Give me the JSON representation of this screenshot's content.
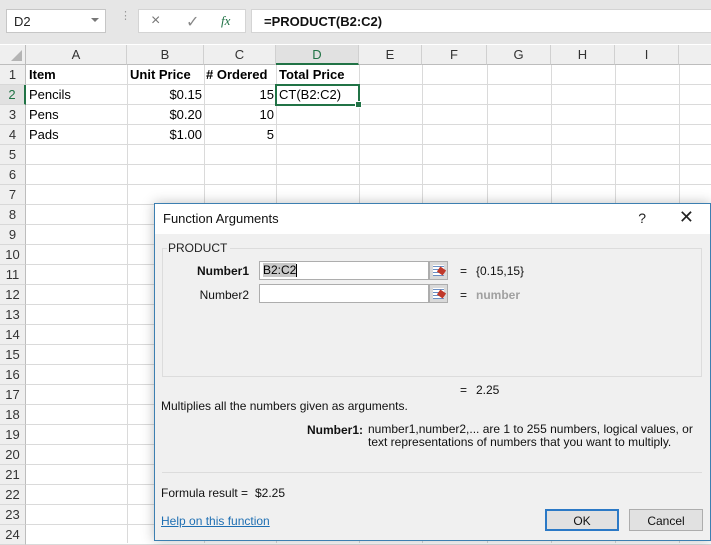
{
  "formula_bar": {
    "name_box": "D2",
    "cancel_icon": "×",
    "enter_icon": "✓",
    "fx_icon": "fx",
    "formula": "=PRODUCT(B2:C2)"
  },
  "columns": [
    "A",
    "B",
    "C",
    "D",
    "E",
    "F",
    "G",
    "H",
    "I",
    ""
  ],
  "selected_column": "D",
  "rows": [
    "1",
    "2",
    "3",
    "4",
    "5",
    "6",
    "7",
    "8",
    "9",
    "10",
    "11",
    "12",
    "13",
    "14",
    "15",
    "16",
    "17",
    "18",
    "19",
    "20",
    "21",
    "22",
    "23",
    "24"
  ],
  "selected_row": "2",
  "cells": {
    "A1": "Item",
    "B1": "Unit Price",
    "C1": "# Ordered",
    "D1": "Total Price",
    "A2": "Pencils",
    "B2": "$0.15",
    "C2": "15",
    "D2": "CT(B2:C2)",
    "A3": "Pens",
    "B3": "$0.20",
    "C3": "10",
    "A4": "Pads",
    "B4": "$1.00",
    "C4": "5"
  },
  "dialog": {
    "title": "Function Arguments",
    "help_icon": "?",
    "close_icon": "✕",
    "function_name": "PRODUCT",
    "arguments": [
      {
        "label": "Number1",
        "value_selected": "B2:C2",
        "equals": "=",
        "result": "{0.15,15}"
      },
      {
        "label": "Number2",
        "value": "",
        "equals": "=",
        "result": "number"
      }
    ],
    "overall_equals": "=",
    "overall_value": "2.25",
    "description": "Multiplies all the numbers given as arguments.",
    "arg_desc_label": "Number1:",
    "arg_desc": "number1,number2,... are 1 to 255 numbers, logical values, or text representations of numbers that you want to multiply.",
    "formula_result_label": "Formula result =",
    "formula_result_value": "$2.25",
    "help_link": "Help on this function",
    "ok_label": "OK",
    "cancel_label": "Cancel"
  }
}
